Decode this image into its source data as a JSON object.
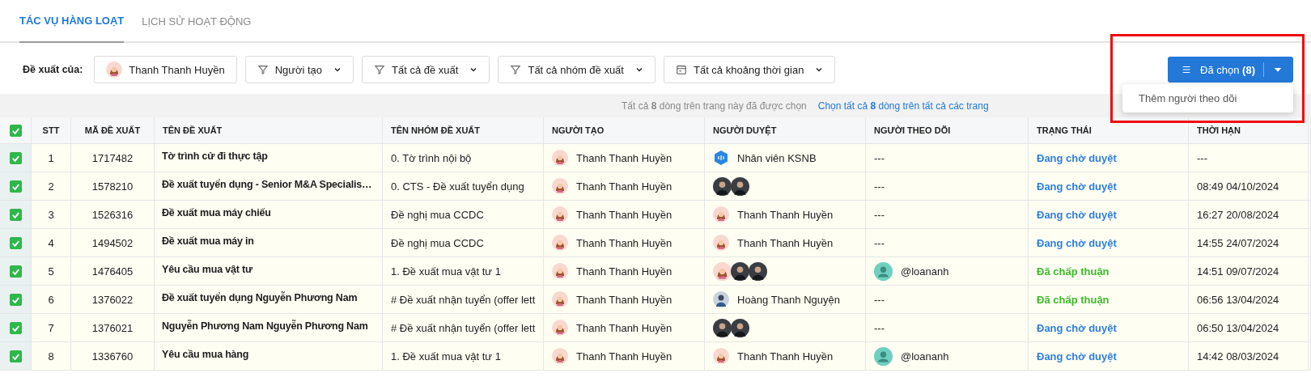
{
  "tabs": [
    {
      "label": "TÁC VỤ HÀNG LOẠT",
      "selected": true
    },
    {
      "label": "LỊCH SỬ HOẠT ĐỘNG",
      "selected": false
    }
  ],
  "filters": {
    "label": "Đề xuất của:",
    "items": [
      {
        "kind": "person",
        "text": "Thanh Thanh Huyền"
      },
      {
        "kind": "filter",
        "text": "Người tạo"
      },
      {
        "kind": "filter",
        "text": "Tất cả đề xuất"
      },
      {
        "kind": "filter",
        "text": "Tất cả nhóm đề xuất"
      },
      {
        "kind": "date",
        "text": "Tất cả khoảng thời gian"
      }
    ]
  },
  "selected_button": {
    "label": "Đã chọn",
    "count": "(8)"
  },
  "menu": {
    "items": [
      "Thêm người theo dõi"
    ]
  },
  "highlight": true,
  "banner": {
    "text": "Tất cả **8** dòng trên trang này đã được chọn",
    "link": "Chọn tất cả **8** dòng trên tất cả các trang"
  },
  "table": {
    "all_checked": true,
    "columns": [
      "STT",
      "MÃ ĐỀ XUẤT",
      "TÊN ĐỀ XUẤT",
      "TÊN NHÓM ĐỀ XUẤT",
      "NGƯỜI TẠO",
      "NGƯỜI DUYỆT",
      "NGƯỜI THEO DÕI",
      "TRẠNG THÁI",
      "THỜI HẠN"
    ],
    "rows": [
      {
        "checked": true,
        "stt": "1",
        "code": "1717482",
        "name": "Tờ trình cử đi thực tập",
        "group": "0. Tờ trình nội bộ",
        "creator": "Thanh Thanh Huyền",
        "approver": {
          "kind": "group",
          "name": "Nhân viên KSNB"
        },
        "follower": {
          "kind": "none",
          "text": "---"
        },
        "status": {
          "kind": "pending",
          "text": "Đang chờ duyệt"
        },
        "deadline": "---"
      },
      {
        "checked": true,
        "stt": "2",
        "code": "1578210",
        "name": "Đề xuất tuyển dụng - Senior M&A Specialis…",
        "group": "0. CTS - Đề xuất tuyển dụng",
        "creator": "Thanh Thanh Huyền",
        "approver": {
          "kind": "avatars",
          "avatars": [
            {
              "kind": "photo"
            },
            {
              "kind": "photo"
            }
          ]
        },
        "follower": {
          "kind": "none",
          "text": "---"
        },
        "status": {
          "kind": "pending",
          "text": "Đang chờ duyệt"
        },
        "deadline": "08:49 04/10/2024"
      },
      {
        "checked": true,
        "stt": "3",
        "code": "1526316",
        "name": "Đề xuất mua máy chiếu",
        "group": "Đề nghị mua CCDC",
        "creator": "Thanh Thanh Huyền",
        "approver": {
          "kind": "person",
          "name": "Thanh Thanh Huyền"
        },
        "follower": {
          "kind": "none",
          "text": "---"
        },
        "status": {
          "kind": "pending",
          "text": "Đang chờ duyệt"
        },
        "deadline": "16:27 20/08/2024"
      },
      {
        "checked": true,
        "stt": "4",
        "code": "1494502",
        "name": "Đề xuất mua máy in",
        "group": "Đề nghị mua CCDC",
        "creator": "Thanh Thanh Huyền",
        "approver": {
          "kind": "person",
          "name": "Thanh Thanh Huyền"
        },
        "follower": {
          "kind": "none",
          "text": "---"
        },
        "status": {
          "kind": "pending",
          "text": "Đang chờ duyệt"
        },
        "deadline": "14:55 24/07/2024"
      },
      {
        "checked": true,
        "stt": "5",
        "code": "1476405",
        "name": "Yêu cầu mua vật tư",
        "group": "1. Đề xuất mua vật tư 1",
        "creator": "Thanh Thanh Huyền",
        "approver": {
          "kind": "avatars",
          "avatars": [
            {
              "kind": "illustration"
            },
            {
              "kind": "photo"
            },
            {
              "kind": "photo"
            }
          ]
        },
        "follower": {
          "kind": "user",
          "text": "@loananh"
        },
        "status": {
          "kind": "approved",
          "text": "Đã chấp thuận"
        },
        "deadline": "14:51 09/07/2024"
      },
      {
        "checked": true,
        "stt": "6",
        "code": "1376022",
        "name": "Đề xuất tuyển dụng Nguyễn Phương Nam",
        "group": "# Đề xuất nhận tuyển (offer lett",
        "creator": "Thanh Thanh Huyền",
        "approver": {
          "kind": "photo-person",
          "name": "Hoàng Thanh Nguyện"
        },
        "follower": {
          "kind": "none",
          "text": "---"
        },
        "status": {
          "kind": "approved",
          "text": "Đã chấp thuận"
        },
        "deadline": "06:56 13/04/2024"
      },
      {
        "checked": true,
        "stt": "7",
        "code": "1376021",
        "name": "Nguyễn Phương Nam Nguyễn Phương Nam",
        "group": "# Đề xuất nhận tuyển (offer lett",
        "creator": "Thanh Thanh Huyền",
        "approver": {
          "kind": "avatars",
          "avatars": [
            {
              "kind": "photo"
            },
            {
              "kind": "photo"
            }
          ]
        },
        "follower": {
          "kind": "none",
          "text": "---"
        },
        "status": {
          "kind": "pending",
          "text": "Đang chờ duyệt"
        },
        "deadline": "06:50 13/04/2024"
      },
      {
        "checked": true,
        "stt": "8",
        "code": "1336760",
        "name": "Yêu cầu mua hàng",
        "group": "1. Đề xuất mua vật tư 1",
        "creator": "Thanh Thanh Huyền",
        "approver": {
          "kind": "person",
          "name": "Thanh Thanh Huyền"
        },
        "follower": {
          "kind": "user",
          "text": "@loananh"
        },
        "status": {
          "kind": "pending",
          "text": "Đang chờ duyệt"
        },
        "deadline": "14:42 08/03/2024"
      }
    ]
  }
}
